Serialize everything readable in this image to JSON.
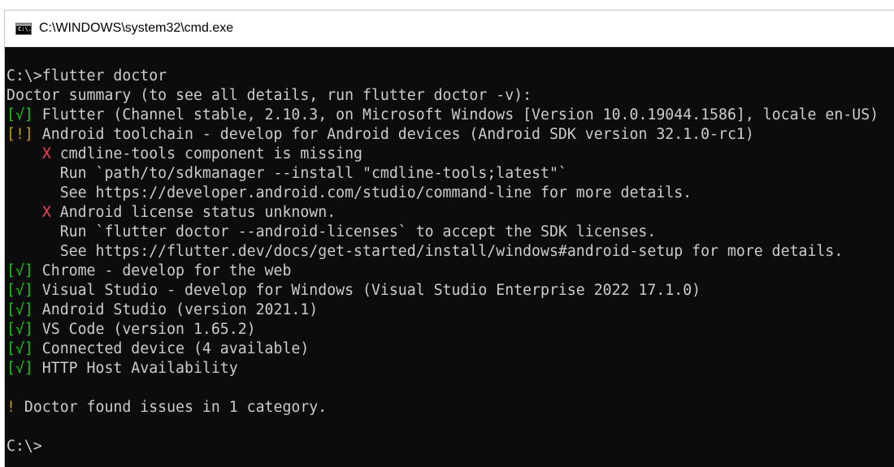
{
  "window": {
    "title": "C:\\WINDOWS\\system32\\cmd.exe",
    "icon": "cmd-icon",
    "icon_glyph": "C:\\."
  },
  "colors": {
    "background": "#0c0c0c",
    "text": "#cccccc",
    "ok": "#16c60c",
    "warn": "#c19c00",
    "error": "#e74856"
  },
  "console": {
    "lines": [
      {
        "prefix": "",
        "prefix_type": "none",
        "text": "C:\\>flutter doctor"
      },
      {
        "prefix": "",
        "prefix_type": "none",
        "text": "Doctor summary (to see all details, run flutter doctor -v):"
      },
      {
        "prefix": "[√]",
        "prefix_type": "ok",
        "text": " Flutter (Channel stable, 2.10.3, on Microsoft Windows [Version 10.0.19044.1586], locale en-US)"
      },
      {
        "prefix": "[!]",
        "prefix_type": "warn",
        "text": " Android toolchain - develop for Android devices (Android SDK version 32.1.0-rc1)"
      },
      {
        "indent": "    ",
        "prefix": "X",
        "prefix_type": "err",
        "text": " cmdline-tools component is missing"
      },
      {
        "prefix": "",
        "prefix_type": "none",
        "text": "      Run `path/to/sdkmanager --install \"cmdline-tools;latest\"`"
      },
      {
        "prefix": "",
        "prefix_type": "none",
        "text": "      See https://developer.android.com/studio/command-line for more details."
      },
      {
        "indent": "    ",
        "prefix": "X",
        "prefix_type": "err",
        "text": " Android license status unknown."
      },
      {
        "prefix": "",
        "prefix_type": "none",
        "text": "      Run `flutter doctor --android-licenses` to accept the SDK licenses."
      },
      {
        "prefix": "",
        "prefix_type": "none",
        "text": "      See https://flutter.dev/docs/get-started/install/windows#android-setup for more details."
      },
      {
        "prefix": "[√]",
        "prefix_type": "ok",
        "text": " Chrome - develop for the web"
      },
      {
        "prefix": "[√]",
        "prefix_type": "ok",
        "text": " Visual Studio - develop for Windows (Visual Studio Enterprise 2022 17.1.0)"
      },
      {
        "prefix": "[√]",
        "prefix_type": "ok",
        "text": " Android Studio (version 2021.1)"
      },
      {
        "prefix": "[√]",
        "prefix_type": "ok",
        "text": " VS Code (version 1.65.2)"
      },
      {
        "prefix": "[√]",
        "prefix_type": "ok",
        "text": " Connected device (4 available)"
      },
      {
        "prefix": "[√]",
        "prefix_type": "ok",
        "text": " HTTP Host Availability"
      },
      {
        "prefix": "",
        "prefix_type": "none",
        "text": ""
      },
      {
        "prefix": "!",
        "prefix_type": "warn",
        "text": " Doctor found issues in 1 category."
      },
      {
        "prefix": "",
        "prefix_type": "none",
        "text": ""
      },
      {
        "prefix": "",
        "prefix_type": "none",
        "text": "C:\\>"
      }
    ]
  }
}
